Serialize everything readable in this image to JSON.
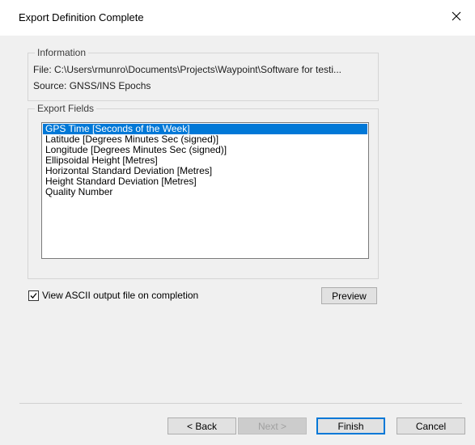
{
  "window": {
    "title": "Export Definition Complete",
    "close_icon": "close-icon"
  },
  "information": {
    "legend": "Information",
    "file": "File: C:\\Users\\rmunro\\Documents\\Projects\\Waypoint\\Software for testi...",
    "source": "Source: GNSS/INS Epochs"
  },
  "export_fields": {
    "legend": "Export Fields",
    "items": [
      "GPS Time [Seconds of the Week]",
      "Latitude [Degrees Minutes Sec (signed)]",
      "Longitude [Degrees Minutes Sec (signed)]",
      "Ellipsoidal Height [Metres]",
      "Horizontal Standard Deviation [Metres]",
      "Height Standard Deviation [Metres]",
      "Quality Number"
    ],
    "selected_index": 0
  },
  "view_ascii": {
    "label": "View ASCII output file on completion",
    "checked": true
  },
  "buttons": {
    "preview": "Preview",
    "back": "< Back",
    "next": "Next >",
    "finish": "Finish",
    "cancel": "Cancel"
  },
  "colors": {
    "selection": "#0078d7",
    "background": "#f0f0f0"
  }
}
